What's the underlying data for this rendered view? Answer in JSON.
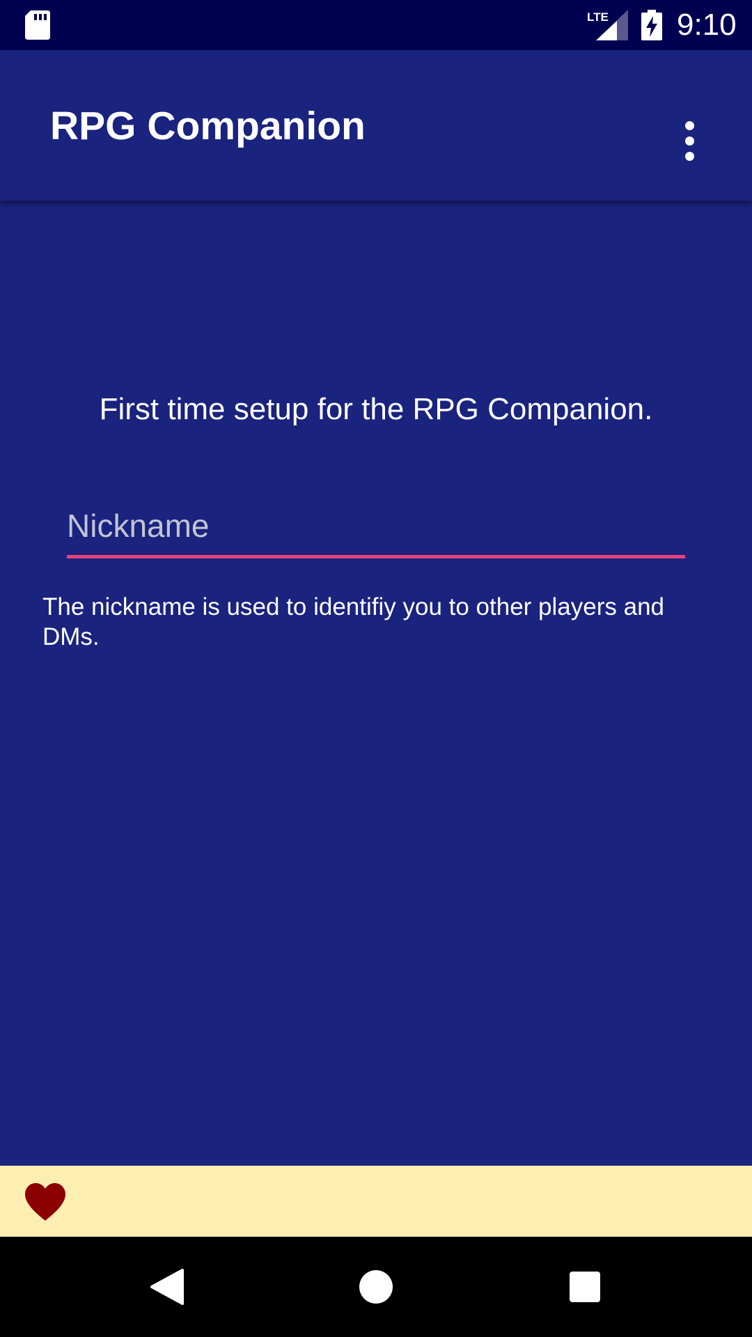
{
  "status_bar": {
    "time": "9:10",
    "network_label": "LTE",
    "icons": [
      "sd-card-icon",
      "lte-signal-icon",
      "battery-charging-icon"
    ]
  },
  "app_bar": {
    "title": "RPG Companion",
    "overflow_icon": "more-vert-icon"
  },
  "setup": {
    "intro": "First time setup for the RPG Companion.",
    "nickname_placeholder": "Nickname",
    "nickname_value": "",
    "help_text": "The nickname is used to identifiy you to other players and DMs."
  },
  "bottom_banner": {
    "icon": "heart-icon"
  },
  "nav_bar": {
    "buttons": [
      "back-icon",
      "home-icon",
      "recents-icon"
    ]
  },
  "colors": {
    "primary": "#1a237e",
    "primary_dark": "#000051",
    "accent": "#ec407a",
    "banner": "#ffeeb2",
    "heart": "#8b0000"
  }
}
